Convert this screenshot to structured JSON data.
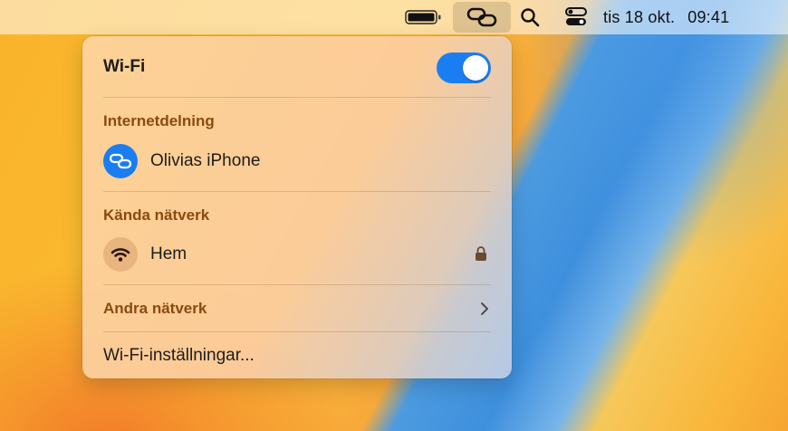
{
  "menubar": {
    "battery_icon": "battery-icon",
    "hotspot_icon": "personal-hotspot-link-icon",
    "search_icon": "magnifying-glass-icon",
    "control_center_icon": "control-center-icon",
    "date": "tis 18 okt.",
    "time": "09:41"
  },
  "panel": {
    "title": "Wi-Fi",
    "wifi_enabled": true,
    "accent_color": "#1a7ef2",
    "hotspot_section": {
      "label": "Internetdelning",
      "device": "Olivias iPhone",
      "icon": "personal-hotspot-link-icon"
    },
    "known_section": {
      "label": "Kända nätverk",
      "network": "Hem",
      "icon": "wifi-icon",
      "lock_icon": "lock-icon"
    },
    "other_networks": {
      "label": "Andra nätverk",
      "icon": "chevron-right-icon"
    },
    "settings_link": "Wi-Fi-inställningar..."
  }
}
